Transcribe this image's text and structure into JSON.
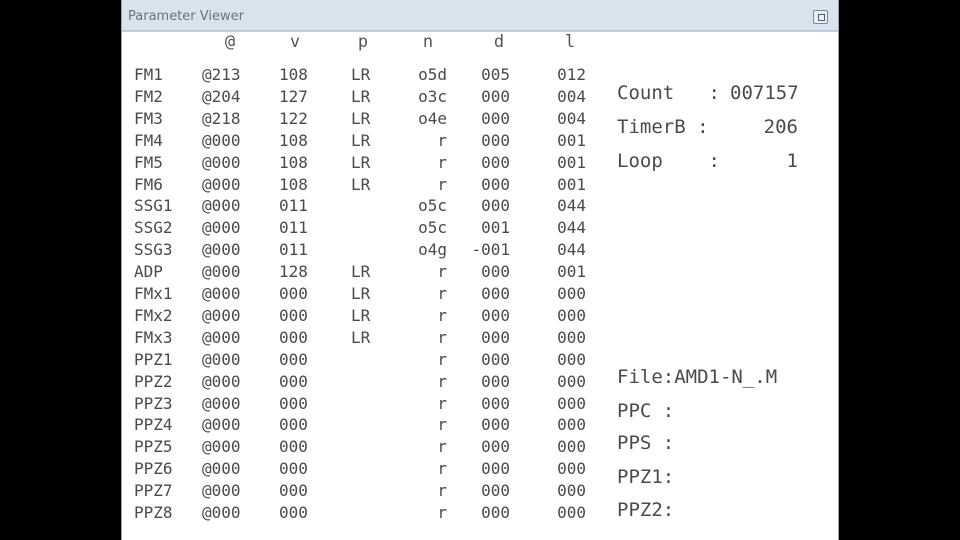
{
  "window": {
    "title": "Parameter Viewer"
  },
  "columns": [
    "@",
    "v",
    "p",
    "n",
    "d",
    "l"
  ],
  "rows": [
    {
      "ch": "FM1",
      "at": "@213",
      "v": "108",
      "p": "LR",
      "n": "o5d",
      "d": "005",
      "l": "012"
    },
    {
      "ch": "FM2",
      "at": "@204",
      "v": "127",
      "p": "LR",
      "n": "o3c",
      "d": "000",
      "l": "004"
    },
    {
      "ch": "FM3",
      "at": "@218",
      "v": "122",
      "p": "LR",
      "n": "o4e",
      "d": "000",
      "l": "004"
    },
    {
      "ch": "FM4",
      "at": "@000",
      "v": "108",
      "p": "LR",
      "n": "r",
      "d": "000",
      "l": "001"
    },
    {
      "ch": "FM5",
      "at": "@000",
      "v": "108",
      "p": "LR",
      "n": "r",
      "d": "000",
      "l": "001"
    },
    {
      "ch": "FM6",
      "at": "@000",
      "v": "108",
      "p": "LR",
      "n": "r",
      "d": "000",
      "l": "001"
    },
    {
      "ch": "SSG1",
      "at": "@000",
      "v": "011",
      "p": "",
      "n": "o5c",
      "d": "000",
      "l": "044"
    },
    {
      "ch": "SSG2",
      "at": "@000",
      "v": "011",
      "p": "",
      "n": "o5c",
      "d": "001",
      "l": "044"
    },
    {
      "ch": "SSG3",
      "at": "@000",
      "v": "011",
      "p": "",
      "n": "o4g",
      "d": "-001",
      "l": "044"
    },
    {
      "ch": "ADP",
      "at": "@000",
      "v": "128",
      "p": "LR",
      "n": "r",
      "d": "000",
      "l": "001"
    },
    {
      "ch": "FMx1",
      "at": "@000",
      "v": "000",
      "p": "LR",
      "n": "r",
      "d": "000",
      "l": "000"
    },
    {
      "ch": "FMx2",
      "at": "@000",
      "v": "000",
      "p": "LR",
      "n": "r",
      "d": "000",
      "l": "000"
    },
    {
      "ch": "FMx3",
      "at": "@000",
      "v": "000",
      "p": "LR",
      "n": "r",
      "d": "000",
      "l": "000"
    },
    {
      "ch": "PPZ1",
      "at": "@000",
      "v": "000",
      "p": "",
      "n": "r",
      "d": "000",
      "l": "000"
    },
    {
      "ch": "PPZ2",
      "at": "@000",
      "v": "000",
      "p": "",
      "n": "r",
      "d": "000",
      "l": "000"
    },
    {
      "ch": "PPZ3",
      "at": "@000",
      "v": "000",
      "p": "",
      "n": "r",
      "d": "000",
      "l": "000"
    },
    {
      "ch": "PPZ4",
      "at": "@000",
      "v": "000",
      "p": "",
      "n": "r",
      "d": "000",
      "l": "000"
    },
    {
      "ch": "PPZ5",
      "at": "@000",
      "v": "000",
      "p": "",
      "n": "r",
      "d": "000",
      "l": "000"
    },
    {
      "ch": "PPZ6",
      "at": "@000",
      "v": "000",
      "p": "",
      "n": "r",
      "d": "000",
      "l": "000"
    },
    {
      "ch": "PPZ7",
      "at": "@000",
      "v": "000",
      "p": "",
      "n": "r",
      "d": "000",
      "l": "000"
    },
    {
      "ch": "PPZ8",
      "at": "@000",
      "v": "000",
      "p": "",
      "n": "r",
      "d": "000",
      "l": "000"
    }
  ],
  "stats": {
    "count_label": "Count   :",
    "count_value": "007157",
    "timerb_label": "TimerB :",
    "timerb_value": "206",
    "loop_label": "Loop    :",
    "loop_value": "1"
  },
  "files": {
    "file_label": "File:AMD1-N_.M",
    "ppc_label": "PPC :",
    "pps_label": "PPS :",
    "ppz1_label": "PPZ1:",
    "ppz2_label": "PPZ2:"
  },
  "colors": {
    "titlebar": "#d9e3ee",
    "content_bg": "#ffffff",
    "text": "#4a4a4a",
    "letterbox": "#000000"
  },
  "icons": {
    "restore": "restore-window-icon"
  }
}
